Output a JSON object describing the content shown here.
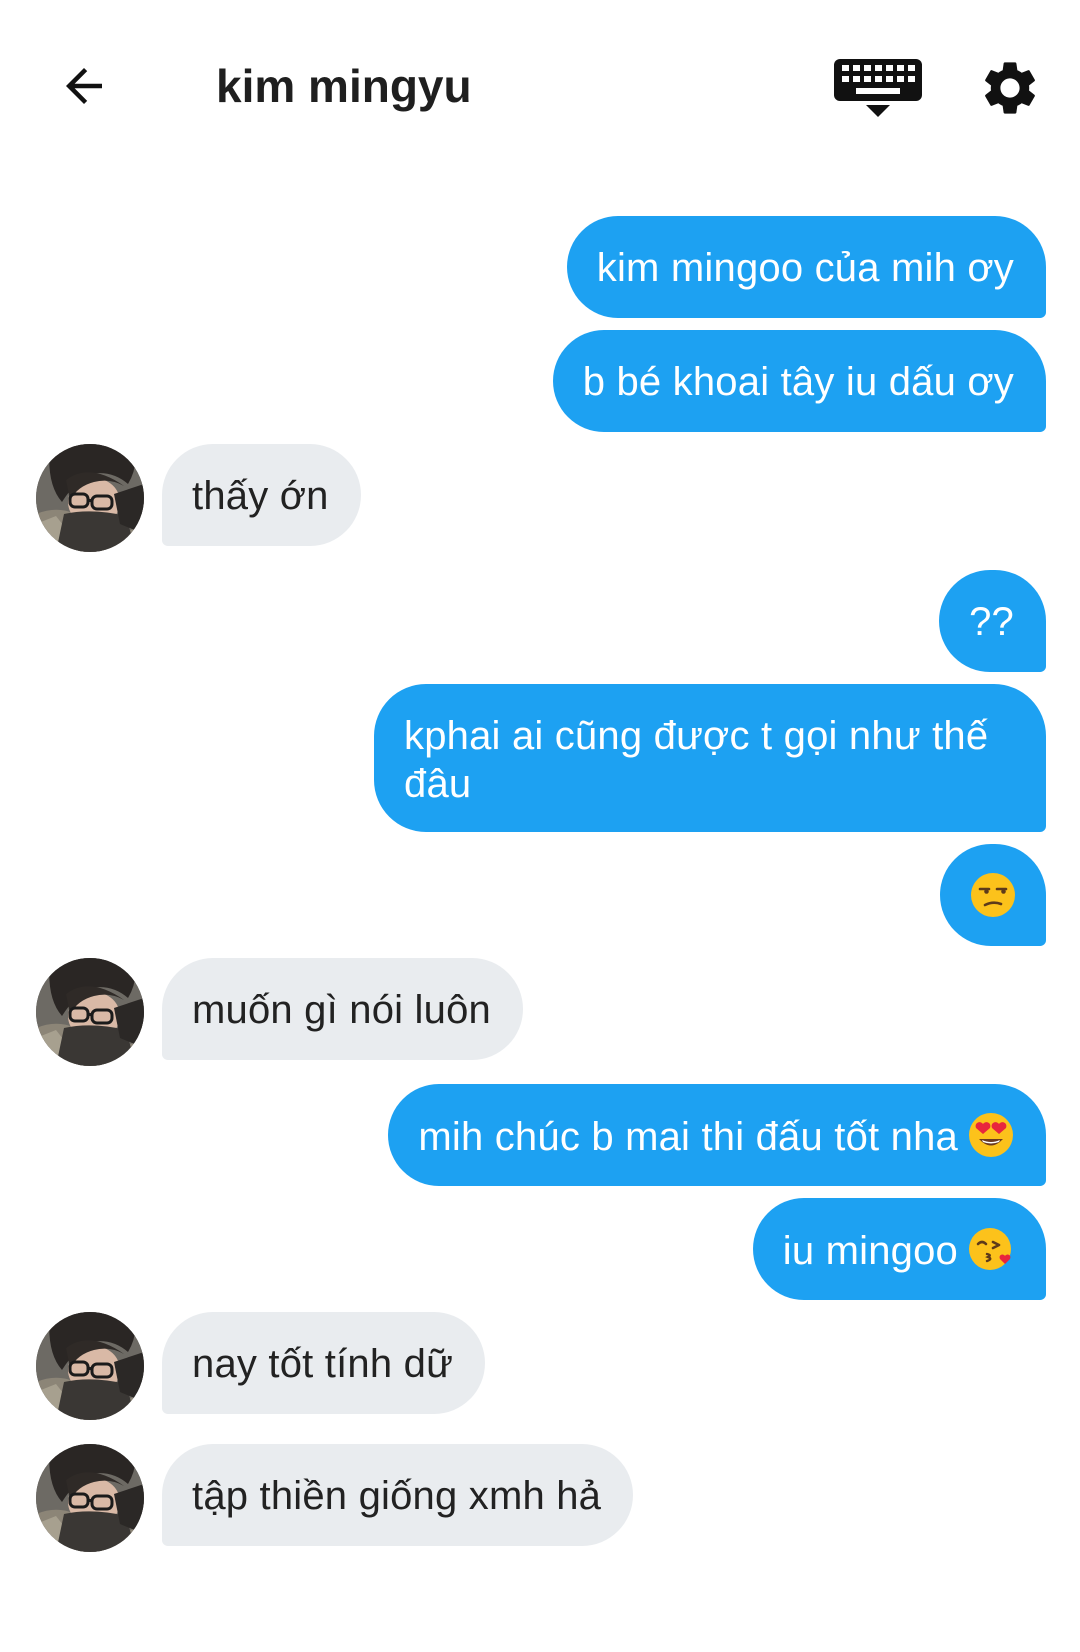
{
  "header": {
    "title": "kim mingyu"
  },
  "icons": {
    "back": "arrow-left-icon",
    "keyboard": "keyboard-icon",
    "settings": "gear-icon"
  },
  "colors": {
    "sent_bubble": "#1da1f2",
    "received_bubble": "#e9ecef",
    "text_dark": "#1f1f1f"
  },
  "messages": [
    {
      "from": "me",
      "text": "kim mingoo của mih ơy"
    },
    {
      "from": "me",
      "text": "b bé khoai tây iu dấu ơy"
    },
    {
      "from": "them",
      "text": "thấy ớn"
    },
    {
      "from": "me",
      "text": "??"
    },
    {
      "from": "me",
      "text": "kphai ai cũng được t gọi như thế đâu"
    },
    {
      "from": "me",
      "text": "",
      "emoji": "unamused-face"
    },
    {
      "from": "them",
      "text": "muốn gì nói luôn"
    },
    {
      "from": "me",
      "text": "mih chúc b mai thi đấu tốt nha",
      "emoji": "heart-eyes-face"
    },
    {
      "from": "me",
      "text": "iu mingoo",
      "emoji": "kissing-heart-face"
    },
    {
      "from": "them",
      "text": "nay tốt tính dữ"
    },
    {
      "from": "them",
      "text": "tập thiền giống xmh hả"
    }
  ]
}
